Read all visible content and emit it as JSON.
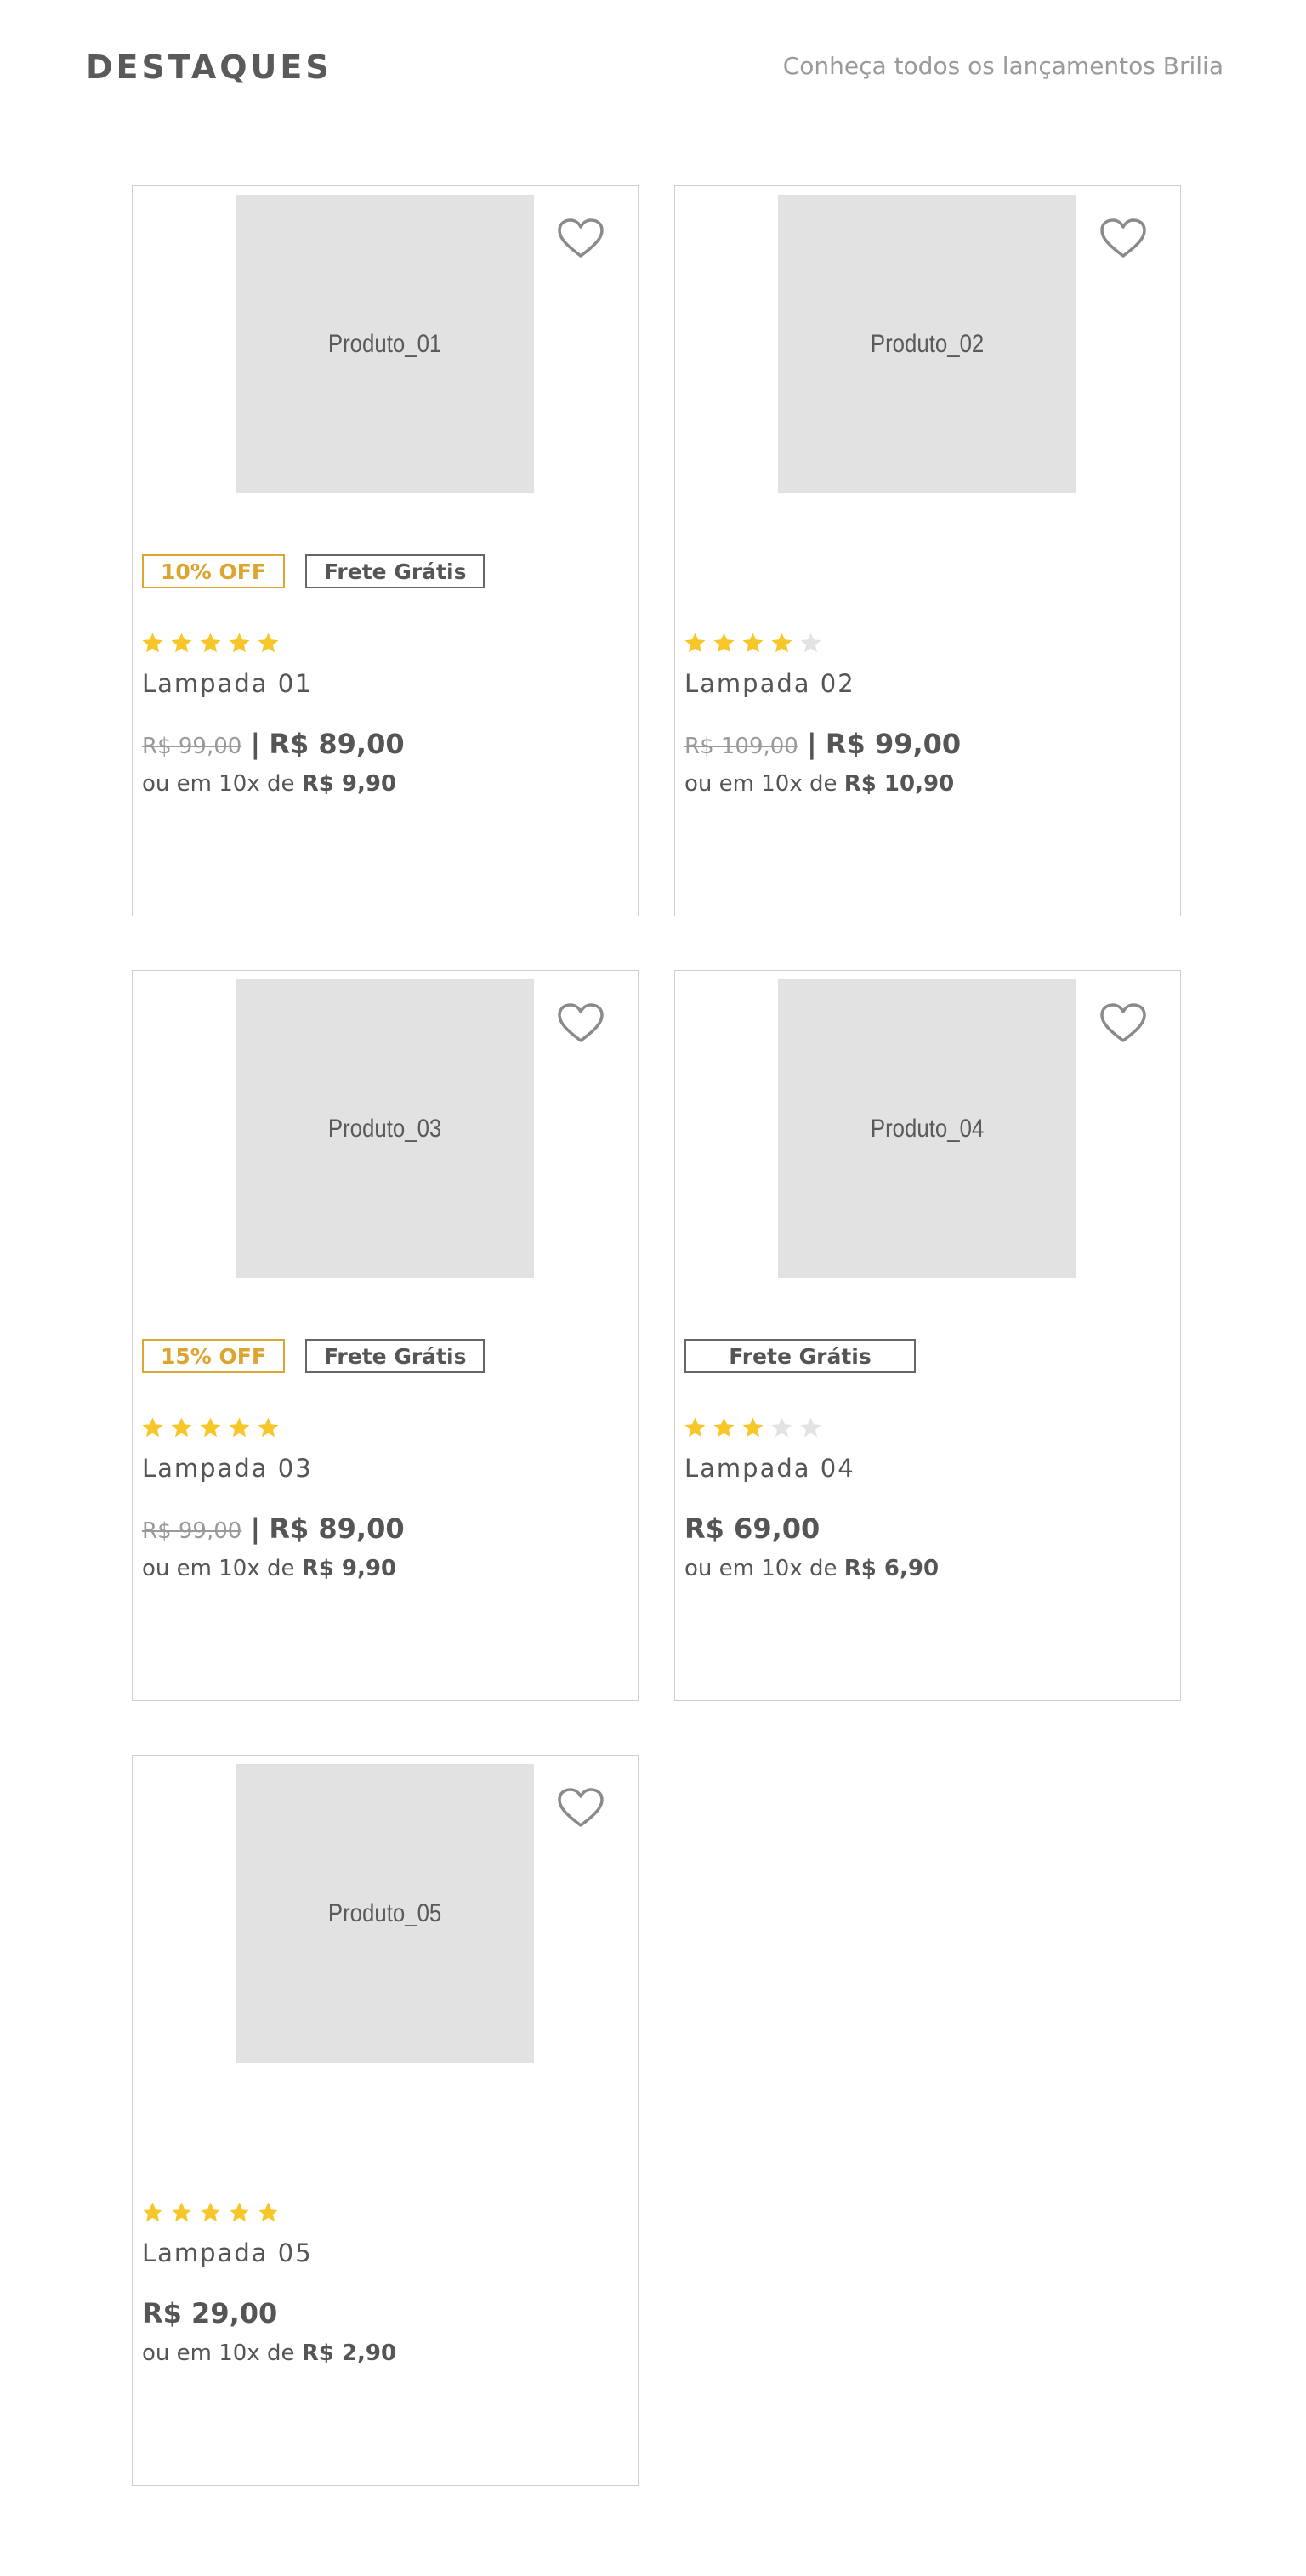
{
  "header": {
    "title": "DESTAQUES",
    "subtitle": "Conheça todos os lançamentos Brilia"
  },
  "colors": {
    "star_filled": "#f7c628",
    "star_empty": "#e3e3e3",
    "discount": "#dca431",
    "border": "#cfcfcf",
    "image_placeholder": "#e2e2e2"
  },
  "icons": {
    "wishlist": "heart-outline-icon",
    "rating": "star-icon"
  },
  "products": [
    {
      "image_label": "Produto_01",
      "discount": "10% OFF",
      "shipping": "Frete Grátis",
      "rating": 5,
      "name": "Lampada 01",
      "old_price": "R$ 99,00",
      "separator": "|",
      "price": "R$ 89,00",
      "installment_text": "ou em 10x de",
      "installment_value": "R$ 9,90"
    },
    {
      "image_label": "Produto_02",
      "discount": "",
      "shipping": "",
      "rating": 4,
      "name": "Lampada 02",
      "old_price": "R$ 109,00",
      "separator": "|",
      "price": "R$ 99,00",
      "installment_text": "ou em 10x de",
      "installment_value": "R$ 10,90"
    },
    {
      "image_label": "Produto_03",
      "discount": "15% OFF",
      "shipping": "Frete Grátis",
      "rating": 5,
      "name": "Lampada 03",
      "old_price": "R$ 99,00",
      "separator": "|",
      "price": "R$ 89,00",
      "installment_text": "ou em 10x de",
      "installment_value": "R$ 9,90"
    },
    {
      "image_label": "Produto_04",
      "discount": "",
      "shipping": "Frete Grátis",
      "rating": 3,
      "name": "Lampada 04",
      "old_price": "",
      "separator": "",
      "price": "R$ 69,00",
      "installment_text": "ou em 10x de",
      "installment_value": "R$ 6,90"
    },
    {
      "image_label": "Produto_05",
      "discount": "",
      "shipping": "",
      "rating": 5,
      "name": "Lampada 05",
      "old_price": "",
      "separator": "",
      "price": "R$ 29,00",
      "installment_text": "ou em 10x de",
      "installment_value": "R$ 2,90"
    }
  ]
}
